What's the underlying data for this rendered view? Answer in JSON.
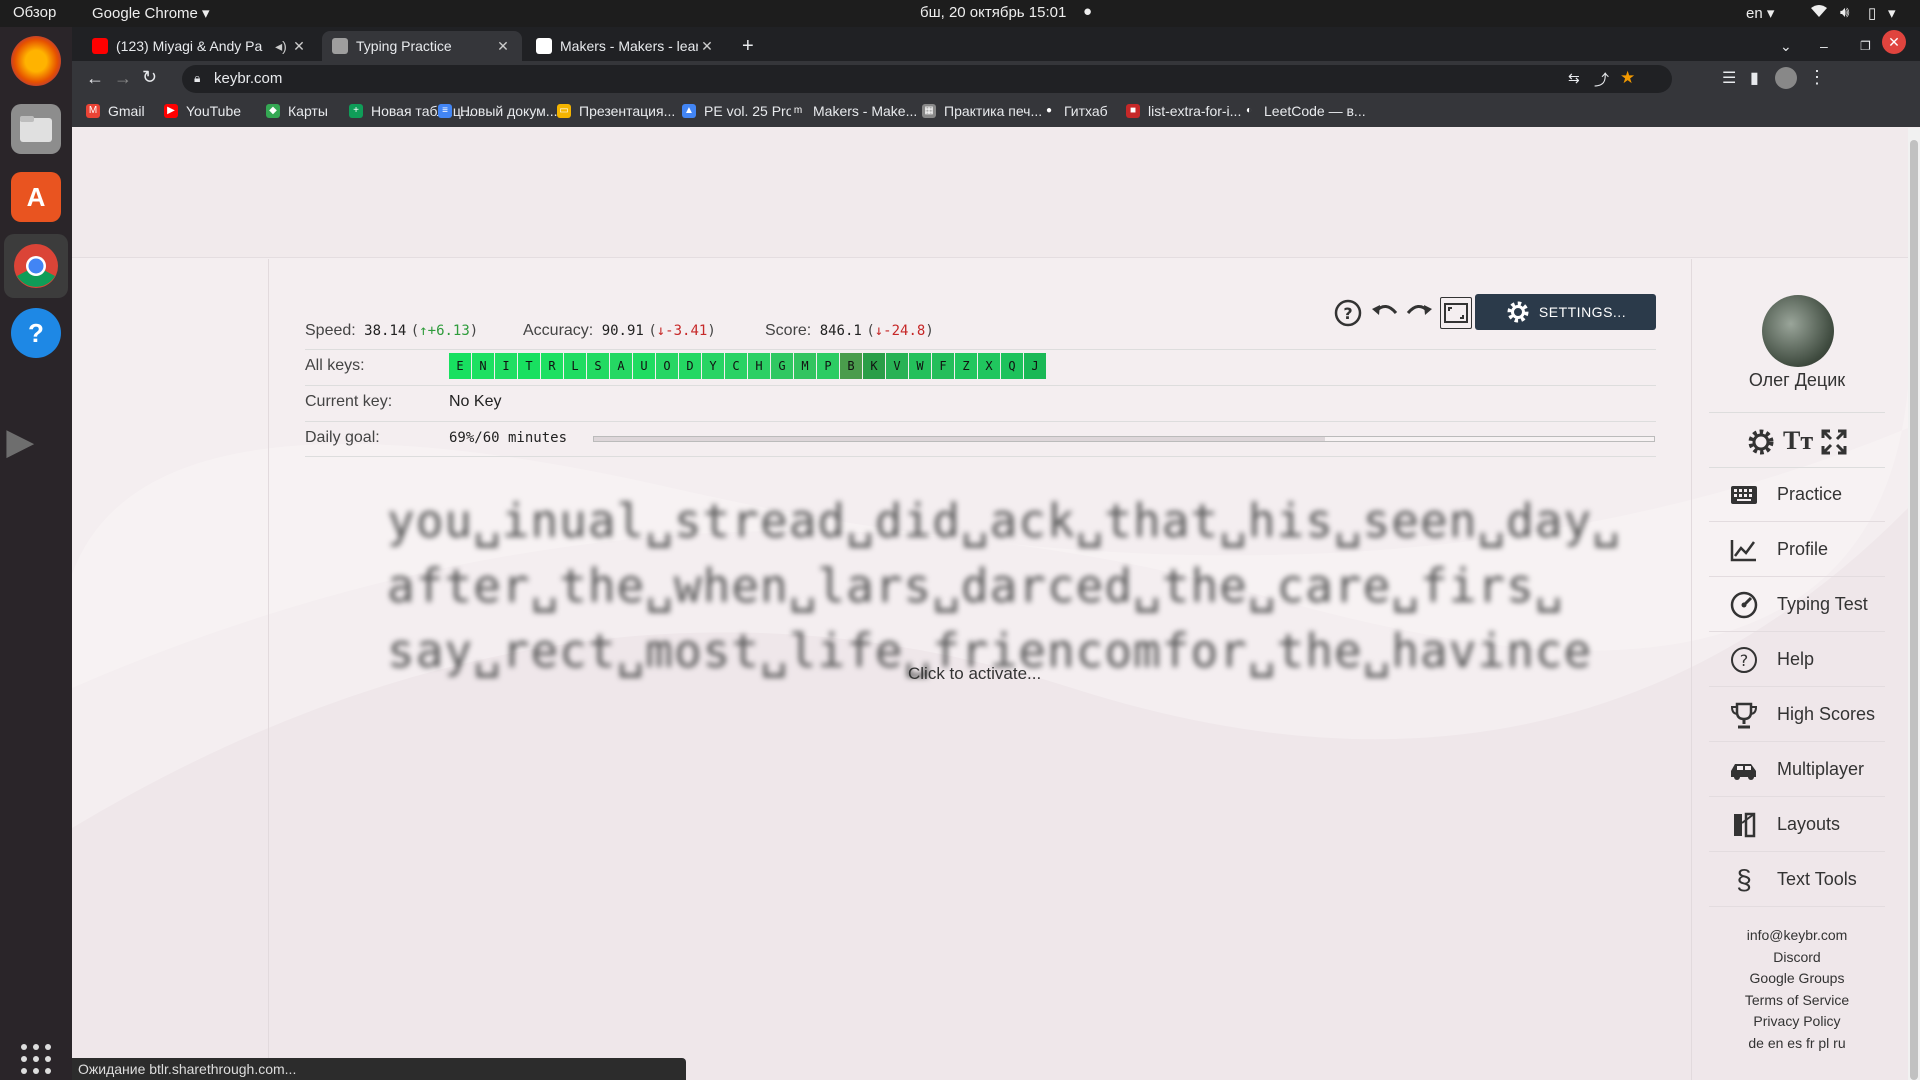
{
  "os": {
    "activities": "Обзор",
    "app_name": "Google Chrome",
    "datetime": "бш, 20 октябрь  15:01",
    "lang": "en"
  },
  "tabs": [
    {
      "label": "(123) Miyagi & Andy Pa",
      "color": "#ff0000"
    },
    {
      "label": "Typing Practice",
      "color": "#9e9e9e"
    },
    {
      "label": "Makers - Makers - learn ev",
      "color": "#ffffff"
    }
  ],
  "url": "keybr.com",
  "bookmarks": [
    {
      "label": "Gmail",
      "color": "#ea4335",
      "icon": "M"
    },
    {
      "label": "YouTube",
      "color": "#ff0000",
      "icon": "▶"
    },
    {
      "label": "Карты",
      "color": "#34a853",
      "icon": "◆"
    },
    {
      "label": "Новая таблиц...",
      "color": "#0f9d58",
      "icon": "+"
    },
    {
      "label": "Новый докум...",
      "color": "#4285f4",
      "icon": "≡"
    },
    {
      "label": "Презентация...",
      "color": "#f4b400",
      "icon": "▭"
    },
    {
      "label": "PE vol. 25 Pro...",
      "color": "#4285f4",
      "icon": "▲"
    },
    {
      "label": "Makers - Make...",
      "color": "#35363a",
      "icon": "m"
    },
    {
      "label": "Практика печ...",
      "color": "#888888",
      "icon": "▦"
    },
    {
      "label": "Гитхаб",
      "color": "#35363a",
      "icon": "●"
    },
    {
      "label": "list-extra-for-i...",
      "color": "#c62828",
      "icon": "■"
    },
    {
      "label": "LeetCode — в...",
      "color": "#35363a",
      "icon": "◐"
    }
  ],
  "stats": {
    "speed_label": "Speed:",
    "speed_value": "38.14",
    "speed_delta": "↑+6.13",
    "accuracy_label": "Accuracy:",
    "accuracy_value": "90.91",
    "accuracy_delta": "↓-3.41",
    "score_label": "Score:",
    "score_value": "846.1",
    "score_delta": "↓-24.8",
    "open_paren": "(",
    "close_paren": ")",
    "all_keys_label": "All keys:",
    "current_key_label": "Current key:",
    "current_key_value": "No Key",
    "daily_goal_label": "Daily goal:",
    "daily_goal_value": "69%/60 minutes",
    "daily_goal_progress": 0.69
  },
  "keys": [
    "E",
    "N",
    "I",
    "T",
    "R",
    "L",
    "S",
    "A",
    "U",
    "O",
    "D",
    "Y",
    "C",
    "H",
    "G",
    "M",
    "P",
    "B",
    "K",
    "V",
    "W",
    "F",
    "Z",
    "X",
    "Q",
    "J"
  ],
  "key_colors": [
    "#18e060",
    "#1ee062",
    "#21de63",
    "#18e060",
    "#1ee062",
    "#20dc62",
    "#22da62",
    "#25d863",
    "#20dc62",
    "#27d664",
    "#24d863",
    "#28d464",
    "#2ad264",
    "#2cd064",
    "#30c862",
    "#33c460",
    "#2ccc63",
    "#4a9c4c",
    "#2a9e48",
    "#28b255",
    "#24c05b",
    "#25be5b",
    "#22c65e",
    "#20c65e",
    "#1ec25c",
    "#1ab856"
  ],
  "practice_lines": [
    "you␣inual␣stread␣did␣ack␣that␣his␣seen␣day␣",
    "after␣the␣when␣lars␣darced␣the␣care␣firs␣",
    "say␣rect␣most␣life␣friencomfor␣the␣havince"
  ],
  "activate_text": "Click to activate...",
  "settings_label": "SETTINGS...",
  "user_name": "Олег Децик",
  "sidebar": [
    {
      "label": "Practice"
    },
    {
      "label": "Profile"
    },
    {
      "label": "Typing Test"
    },
    {
      "label": "Help"
    },
    {
      "label": "High Scores"
    },
    {
      "label": "Multiplayer"
    },
    {
      "label": "Layouts"
    },
    {
      "label": "Text Tools"
    }
  ],
  "footer_links": [
    "info@keybr.com",
    "Discord",
    "Google Groups",
    "Terms of Service",
    "Privacy Policy",
    "de en es fr pl ru"
  ],
  "status_text": "Ожидание btlr.sharethrough.com..."
}
